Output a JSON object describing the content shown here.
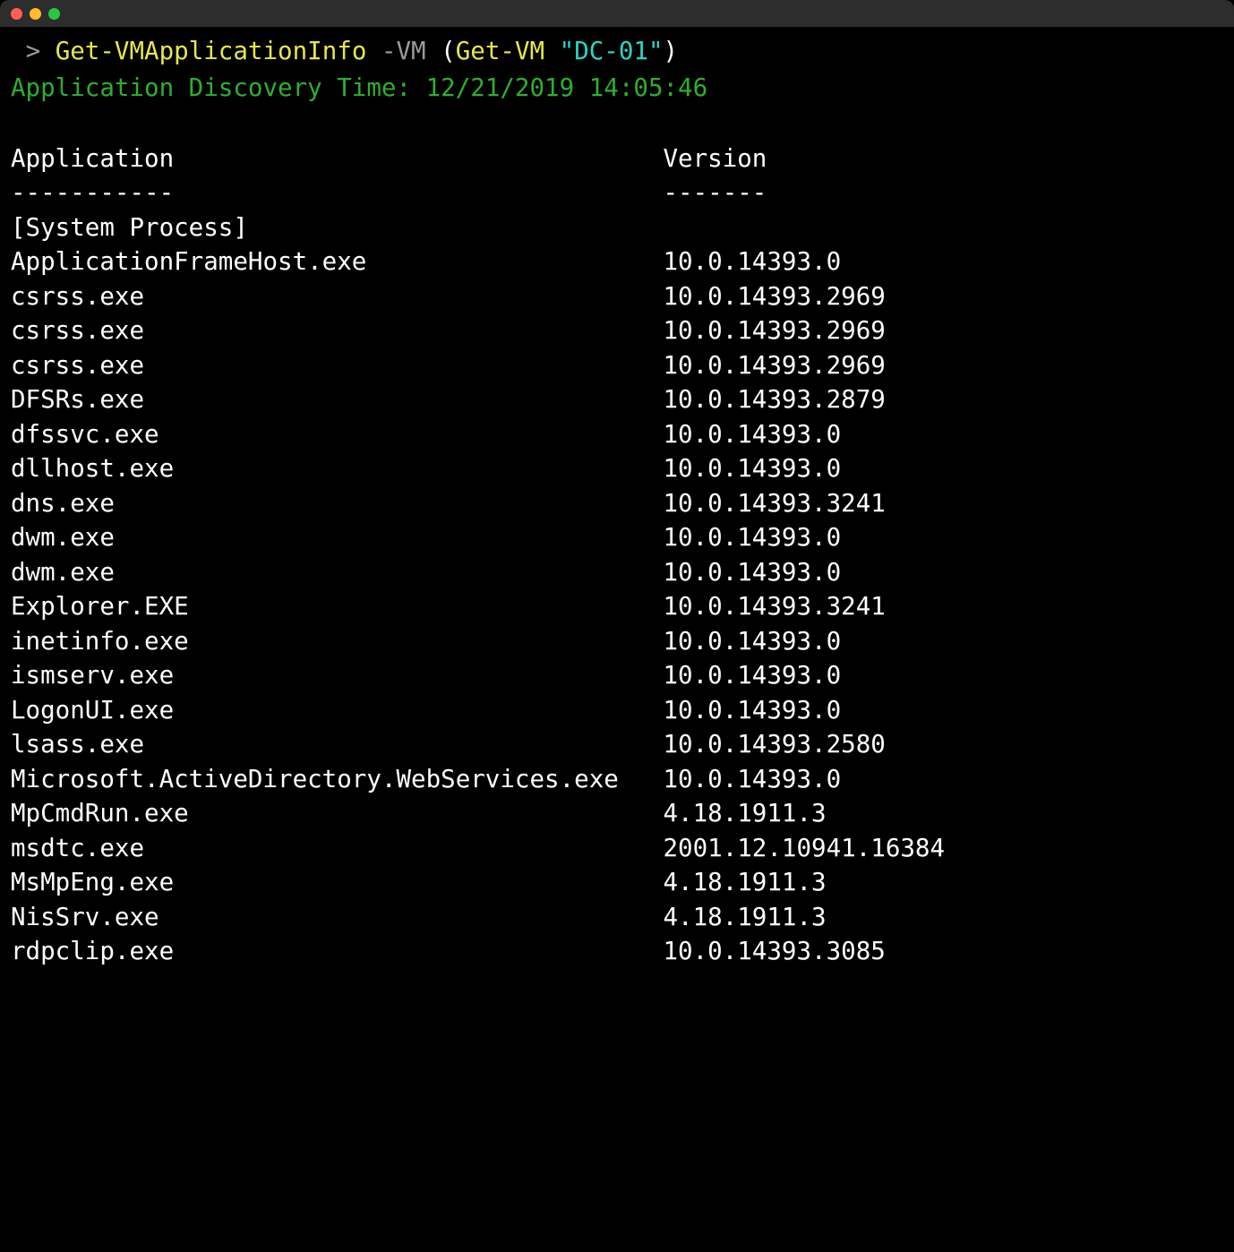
{
  "prompt": {
    "caret": ">",
    "cmdlet": "Get-VMApplicationInfo",
    "param": "-VM",
    "open_paren": "(",
    "inner_cmdlet": "Get-VM",
    "vm_arg": "\"DC-01\"",
    "close_paren": ")"
  },
  "discovery": {
    "label": "Application Discovery Time:",
    "timestamp": "12/21/2019 14:05:46"
  },
  "headers": {
    "application": "Application",
    "version": "Version",
    "application_underline": "-----------",
    "version_underline": "-------"
  },
  "rows": [
    {
      "app": "[System Process]",
      "ver": ""
    },
    {
      "app": "ApplicationFrameHost.exe",
      "ver": "10.0.14393.0"
    },
    {
      "app": "csrss.exe",
      "ver": "10.0.14393.2969"
    },
    {
      "app": "csrss.exe",
      "ver": "10.0.14393.2969"
    },
    {
      "app": "csrss.exe",
      "ver": "10.0.14393.2969"
    },
    {
      "app": "DFSRs.exe",
      "ver": "10.0.14393.2879"
    },
    {
      "app": "dfssvc.exe",
      "ver": "10.0.14393.0"
    },
    {
      "app": "dllhost.exe",
      "ver": "10.0.14393.0"
    },
    {
      "app": "dns.exe",
      "ver": "10.0.14393.3241"
    },
    {
      "app": "dwm.exe",
      "ver": "10.0.14393.0"
    },
    {
      "app": "dwm.exe",
      "ver": "10.0.14393.0"
    },
    {
      "app": "Explorer.EXE",
      "ver": "10.0.14393.3241"
    },
    {
      "app": "inetinfo.exe",
      "ver": "10.0.14393.0"
    },
    {
      "app": "ismserv.exe",
      "ver": "10.0.14393.0"
    },
    {
      "app": "LogonUI.exe",
      "ver": "10.0.14393.0"
    },
    {
      "app": "lsass.exe",
      "ver": "10.0.14393.2580"
    },
    {
      "app": "Microsoft.ActiveDirectory.WebServices.exe",
      "ver": "10.0.14393.0"
    },
    {
      "app": "MpCmdRun.exe",
      "ver": "4.18.1911.3"
    },
    {
      "app": "msdtc.exe",
      "ver": "2001.12.10941.16384"
    },
    {
      "app": "MsMpEng.exe",
      "ver": "4.18.1911.3"
    },
    {
      "app": "NisSrv.exe",
      "ver": "4.18.1911.3"
    },
    {
      "app": "rdpclip.exe",
      "ver": "10.0.14393.3085"
    }
  ]
}
